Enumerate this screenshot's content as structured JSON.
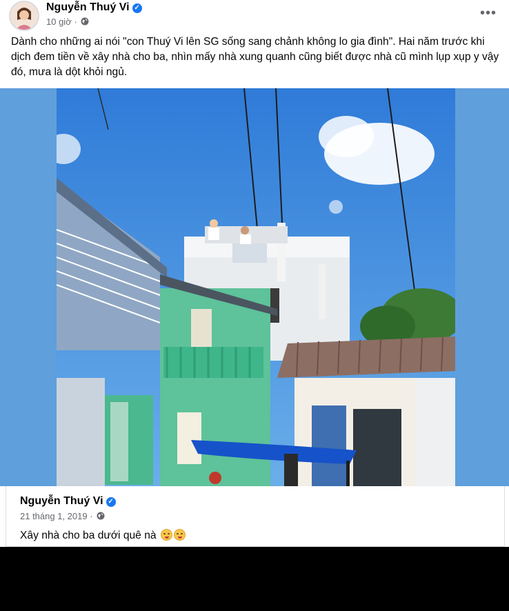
{
  "post": {
    "author": "Nguyễn Thuý Vi",
    "time": "10 giờ ·",
    "text": "Dành cho những ai nói \"con Thuý Vi lên SG sống sang chảnh không lo gia đình\". Hai năm trước khi dịch đem tiền về xây nhà cho ba, nhìn mấy nhà xung quanh cũng biết được nhà cũ mình lụp xụp y vậy đó, mưa là dột khỏi ngủ.",
    "more_icon": "more-horizontal-icon"
  },
  "photo": {
    "background": "#5f9fdc",
    "sky": "#3a7fd6"
  },
  "shared_post": {
    "author": "Nguyễn Thuý Vi",
    "date": "21 tháng 1, 2019 ·",
    "text": "Xây nhà cho ba dưới quê nà",
    "emojis": [
      "smiling-face-emoji",
      "smiling-face-emoji"
    ]
  },
  "colors": {
    "verified": "#1877f2",
    "meta_text": "#65676b"
  }
}
